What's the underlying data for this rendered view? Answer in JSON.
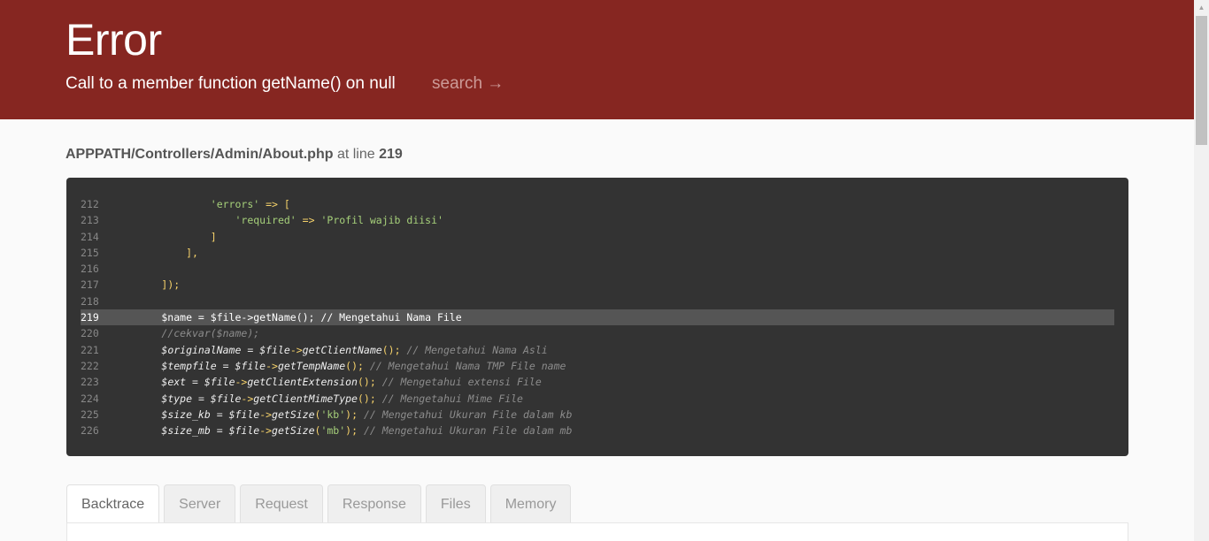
{
  "header": {
    "title": "Error",
    "message": "Call to a member function getName() on null",
    "search_label": "search →"
  },
  "location": {
    "path": "APPPATH/Controllers/Admin/About.php",
    "at_text": " at line ",
    "line": "219"
  },
  "source": {
    "lines": [
      {
        "n": "212",
        "code": "                'errors' => ["
      },
      {
        "n": "213",
        "code": "                    'required' => 'Profil wajib diisi'"
      },
      {
        "n": "214",
        "code": "                ]"
      },
      {
        "n": "215",
        "code": "            ],"
      },
      {
        "n": "216",
        "code": ""
      },
      {
        "n": "217",
        "code": "        ]);"
      },
      {
        "n": "218",
        "code": ""
      },
      {
        "n": "219",
        "code": "        $name = $file->getName(); // Mengetahui Nama File",
        "highlight": true
      },
      {
        "n": "220",
        "code": "        //cekvar($name);"
      },
      {
        "n": "221",
        "code": "        $originalName = $file->getClientName(); // Mengetahui Nama Asli"
      },
      {
        "n": "222",
        "code": "        $tempfile = $file->getTempName(); // Mengetahui Nama TMP File name"
      },
      {
        "n": "223",
        "code": "        $ext = $file->getClientExtension(); // Mengetahui extensi File"
      },
      {
        "n": "224",
        "code": "        $type = $file->getClientMimeType(); // Mengetahui Mime File"
      },
      {
        "n": "225",
        "code": "        $size_kb = $file->getSize('kb'); // Mengetahui Ukuran File dalam kb"
      },
      {
        "n": "226",
        "code": "        $size_mb = $file->getSize('mb'); // Mengetahui Ukuran File dalam mb"
      }
    ]
  },
  "tabs": [
    {
      "label": "Backtrace",
      "active": true
    },
    {
      "label": "Server"
    },
    {
      "label": "Request"
    },
    {
      "label": "Response"
    },
    {
      "label": "Files"
    },
    {
      "label": "Memory"
    }
  ],
  "colors": {
    "header_bg": "#862621",
    "code_bg": "#333333",
    "highlight_bg": "#555555"
  }
}
